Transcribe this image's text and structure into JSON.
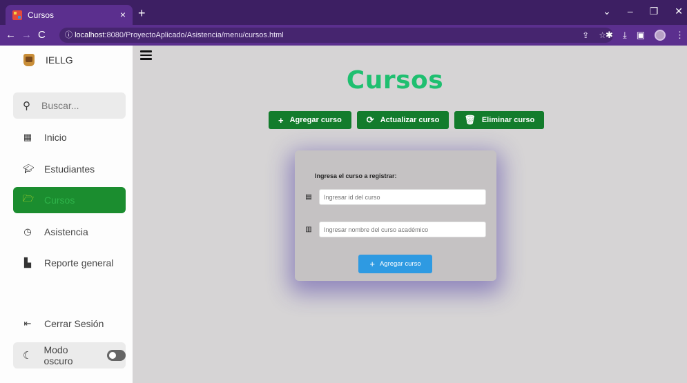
{
  "browser": {
    "tab_title": "Cursos",
    "url_host": "localhost",
    "url_rest": ":8080/ProyectoAplicado/Asistencia/menu/cursos.html"
  },
  "sidebar": {
    "brand": "IELLG",
    "search_placeholder": "Buscar...",
    "items": [
      {
        "label": "Inicio",
        "icon": "grid-icon"
      },
      {
        "label": "Estudiantes",
        "icon": "graduation-cap-icon"
      },
      {
        "label": "Cursos",
        "icon": "folder-icon",
        "active": true
      },
      {
        "label": "Asistencia",
        "icon": "clock-icon"
      },
      {
        "label": "Reporte general",
        "icon": "file-chart-icon"
      }
    ],
    "logout": "Cerrar Sesión",
    "dark_mode": "Modo oscuro",
    "dark_mode_on": false
  },
  "main": {
    "title": "Cursos",
    "actions": {
      "add": "Agregar curso",
      "update": "Actualizar curso",
      "delete": "Eliminar curso"
    },
    "form": {
      "label": "Ingresa el curso a registrar:",
      "id_placeholder": "Ingresar id del curso",
      "name_placeholder": "Ingresar nombre del curso académico",
      "submit": "Agregar curso"
    }
  },
  "colors": {
    "accent_green": "#1fbf70",
    "button_green": "#137c2c",
    "button_blue": "#2e9ae2",
    "browser_purple": "#5b2f8e"
  }
}
